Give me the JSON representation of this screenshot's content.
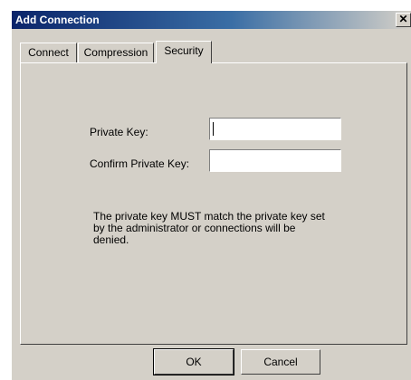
{
  "window": {
    "title": "Add Connection",
    "close_glyph": "✕"
  },
  "tabs": [
    {
      "label": "Connect",
      "selected": false
    },
    {
      "label": "Compression",
      "selected": false
    },
    {
      "label": "Security",
      "selected": true
    }
  ],
  "form": {
    "private_key_label": "Private Key:",
    "private_key_value": "",
    "confirm_key_label": "Confirm Private Key:",
    "confirm_key_value": ""
  },
  "note": "The private key MUST match the private key set by the administrator or connections will be denied.",
  "buttons": {
    "ok": "OK",
    "cancel": "Cancel"
  }
}
